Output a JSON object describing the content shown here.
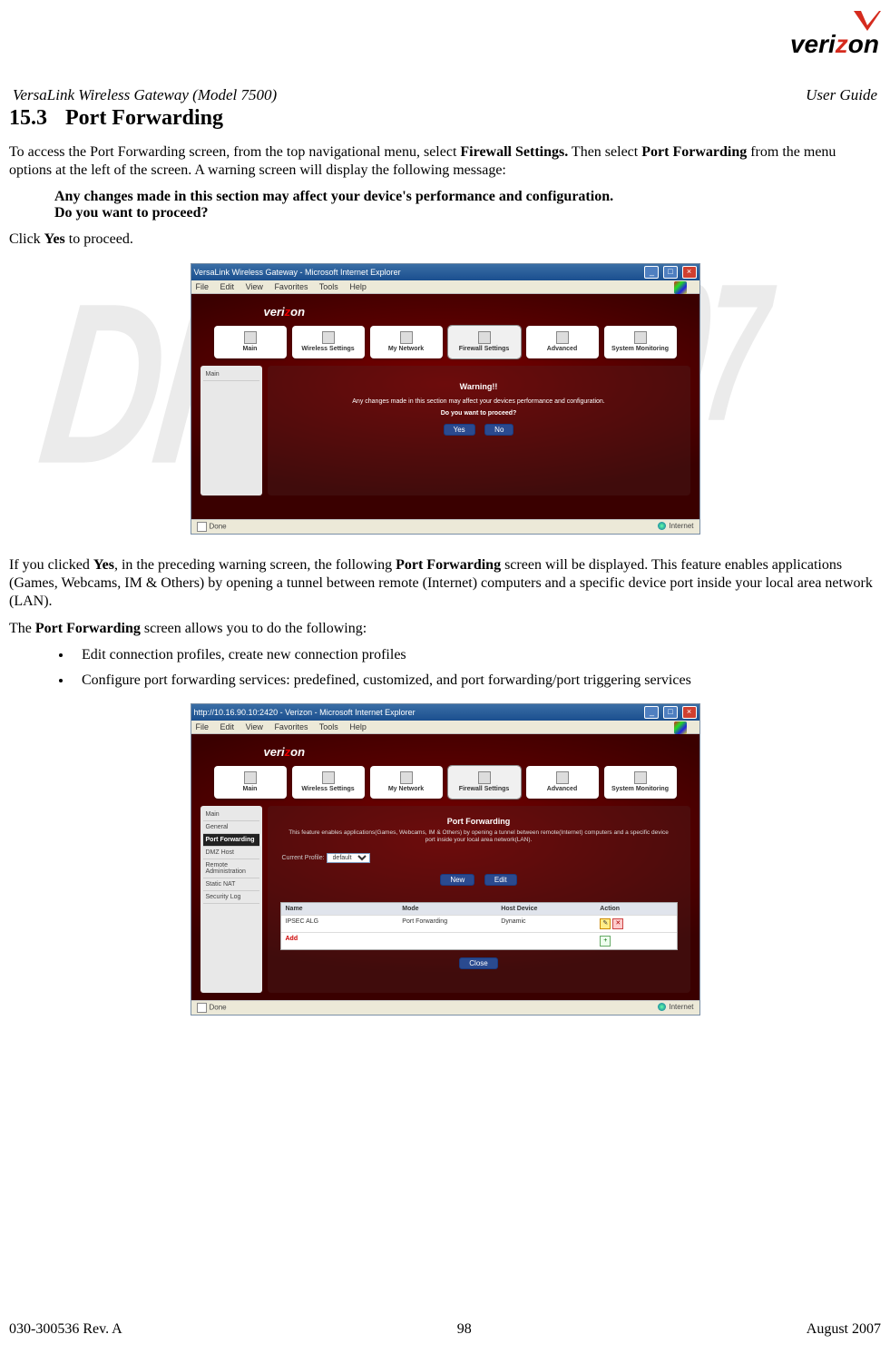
{
  "watermark": {
    "text1": "DRAFT",
    "text2": "9/07"
  },
  "header": {
    "left": "VersaLink Wireless Gateway (Model 7500)",
    "right": "User Guide"
  },
  "section": {
    "num": "15.3",
    "title": "Port Forwarding"
  },
  "para1_a": "To access the Port Forwarding screen, from the top navigational menu, select ",
  "para1_b": "Firewall Settings.",
  "para1_c": " Then select ",
  "para1_d": "Port Forwarding",
  "para1_e": " from the menu options at the left of the screen. A warning screen will display the following message:",
  "warn_msg1": "Any changes made in this section may affect your device's performance and configuration.",
  "warn_msg2": "Do you want to proceed?",
  "para2_a": "Click ",
  "para2_b": "Yes",
  "para2_c": " to proceed.",
  "ss1": {
    "title": "VersaLink Wireless Gateway - Microsoft Internet Explorer",
    "menu": [
      "File",
      "Edit",
      "View",
      "Favorites",
      "Tools",
      "Help"
    ],
    "brand_a": "veri",
    "brand_z": "z",
    "brand_b": "on",
    "nav": [
      "Main",
      "Wireless Settings",
      "My Network",
      "Firewall Settings",
      "Advanced",
      "System Monitoring"
    ],
    "nav_selected": 3,
    "side": [
      "Main"
    ],
    "warn_title": "Warning!!",
    "warn_text": "Any changes made in this section may affect your devices performance and configuration.",
    "warn_q": "Do you want to proceed?",
    "yes": "Yes",
    "no": "No",
    "status_left": "Done",
    "status_right": "Internet"
  },
  "para3_a": "If you clicked ",
  "para3_b": "Yes",
  "para3_c": ", in the preceding warning screen, the following ",
  "para3_d": "Port Forwarding",
  "para3_e": " screen will be displayed. This feature enables applications (Games, Webcams, IM & Others) by opening a tunnel between remote (Internet) computers and a specific device port inside your local area network (LAN).",
  "para4_a": "The ",
  "para4_b": "Port Forwarding",
  "para4_c": " screen allows you to do the following:",
  "bullets": [
    "Edit connection profiles, create new connection profiles",
    "Configure port forwarding services: predefined, customized, and port forwarding/port triggering services"
  ],
  "ss2": {
    "title": "http://10.16.90.10:2420 - Verizon - Microsoft Internet Explorer",
    "menu": [
      "File",
      "Edit",
      "View",
      "Favorites",
      "Tools",
      "Help"
    ],
    "brand_a": "veri",
    "brand_z": "z",
    "brand_b": "on",
    "nav": [
      "Main",
      "Wireless Settings",
      "My Network",
      "Firewall Settings",
      "Advanced",
      "System Monitoring"
    ],
    "nav_selected": 3,
    "side": [
      "Main",
      "General",
      "Port Forwarding",
      "DMZ Host",
      "Remote Administration",
      "Static NAT",
      "Security Log"
    ],
    "side_selected": 2,
    "panel_title": "Port Forwarding",
    "panel_desc": "This feature enables applications(Games, Webcams, IM & Others) by opening a tunnel between remote(Internet) computers and a specific device port inside your local area network(LAN).",
    "profile_label": "Current Profile:",
    "profile_value": "default",
    "btn_new": "New",
    "btn_edit": "Edit",
    "th": [
      "Name",
      "Mode",
      "Host Device",
      "Action"
    ],
    "row": {
      "name": "IPSEC ALG",
      "mode": "Port Forwarding",
      "host": "Dynamic"
    },
    "add": "Add",
    "close": "Close",
    "status_left": "Done",
    "status_right": "Internet"
  },
  "footer": {
    "left": "030-300536 Rev. A",
    "center": "98",
    "right": "August 2007"
  },
  "logo": {
    "brand_a": "veri",
    "brand_z": "z",
    "brand_b": "on"
  }
}
